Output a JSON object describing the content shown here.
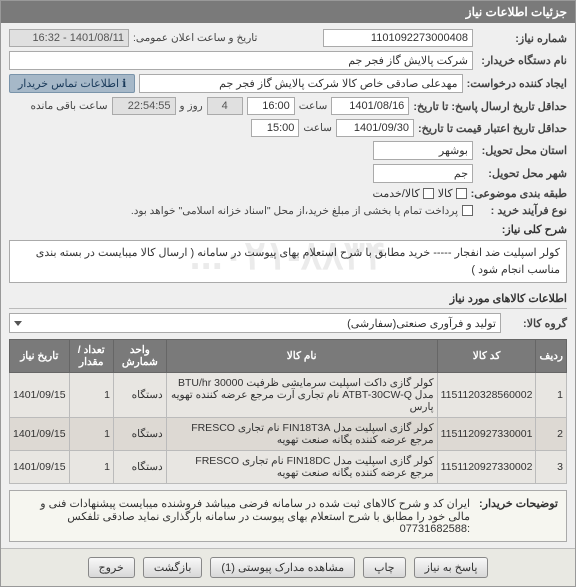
{
  "panel_title": "جزئیات اطلاعات نیاز",
  "fields": {
    "need_no_label": "شماره نیاز:",
    "need_no": "1101092273000408",
    "announce_label": "تاریخ و ساعت اعلان عمومی:",
    "announce_value": "1401/08/11 - 16:32",
    "buyer_label": "نام دستگاه خریدار:",
    "buyer_value": "شرکت پالایش گاز فجر جم",
    "requester_label": "ایجاد کننده درخواست:",
    "requester_value": "مهدعلی صادقی خاص کالا شرکت پالایش گاز فجر جم",
    "contact_link": "اطلاعات تماس خریدار",
    "deadline_label": "حداقل تاریخ ارسال پاسخ: تا تاریخ:",
    "deadline_date": "1401/08/16",
    "deadline_time_lbl": "ساعت",
    "deadline_time": "16:00",
    "deadline_days": "4",
    "deadline_days_suffix": "روز و",
    "deadline_count": "22:54:55",
    "deadline_remain": "ساعت باقی مانده",
    "validity_label": "حداقل تاریخ اعتبار قیمت تا تاریخ:",
    "validity_date": "1401/09/30",
    "validity_time": "15:00",
    "province_lbl": "استان محل تحویل:",
    "province_val": "بوشهر",
    "city_lbl": "شهر محل تحویل:",
    "city_val": "جم",
    "cat_lbl": "طبقه بندی موضوعی:",
    "cat_goods": "کالا",
    "cat_service": "کالا/خدمت",
    "purchase_type_lbl": "نوع فرآیند خرید :",
    "purchase_type_note": "پرداخت تمام یا بخشی از مبلغ خرید،از محل \"اسناد خزانه اسلامی\" خواهد بود.",
    "need_desc_lbl": "شرح کلی نیاز:",
    "need_desc": "کولر اسپلیت ضد انفجار ----- خرید مطابق با شرح استعلام بهای پیوست در سامانه ( ارسال کالا میبایست در بسته بندی مناسب انجام شود )",
    "goods_header": "اطلاعات کالاهای مورد نیاز",
    "group_lbl": "گروه کالا:",
    "group_val": "تولید و فرآوری صنعتی(سفارشی)"
  },
  "table": {
    "headers": {
      "row": "ردیف",
      "code": "کد کالا",
      "name": "نام کالا",
      "unit": "واحد شمارش",
      "qty": "تعداد / مقدار",
      "date": "تاریخ نیاز"
    },
    "rows": [
      {
        "n": "1",
        "code": "1151120328560002",
        "name": "کولر گازی داکت اسپلیت سرمایشی ظرفیت BTU/hr 30000 مدل ATBT-30CW-Q نام تجاری  آرت مرجع عرضه کننده تهویه پارس",
        "unit": "دستگاه",
        "qty": "1",
        "date": "1401/09/15"
      },
      {
        "n": "2",
        "code": "1151120927330001",
        "name": "کولر گازی اسپلیت مدل FIN18T3A نام تجاری FRESCO مرجع عرضه کننده یگانه صنعت تهویه",
        "unit": "دستگاه",
        "qty": "1",
        "date": "1401/09/15"
      },
      {
        "n": "3",
        "code": "1151120927330002",
        "name": "کولر گازی اسپلیت مدل FIN18DC نام تجاری FRESCO مرجع عرضه کننده یگانه صنعت تهویه",
        "unit": "دستگاه",
        "qty": "1",
        "date": "1401/09/15"
      }
    ]
  },
  "footer": {
    "note_lbl": "توضیحات خریدار:",
    "note_text": "ایران کد و شرح کالاهای ثبت شده در سامانه فرضی میباشد فروشنده میبایست پیشنهادات فنی و مالی خود را مطابق با شرح استعلام بهای پیوست در سامانه بارگذاری نماید     صادقی    تلفکس :07731682588"
  },
  "buttons": {
    "print": "چاپ",
    "attach": "مشاهده مدارک پیوستی (1)",
    "back": "بازگشت",
    "exit": "خروج",
    "reply": "پاسخ به نیاز"
  },
  "icons": {
    "info": "ℹ"
  }
}
